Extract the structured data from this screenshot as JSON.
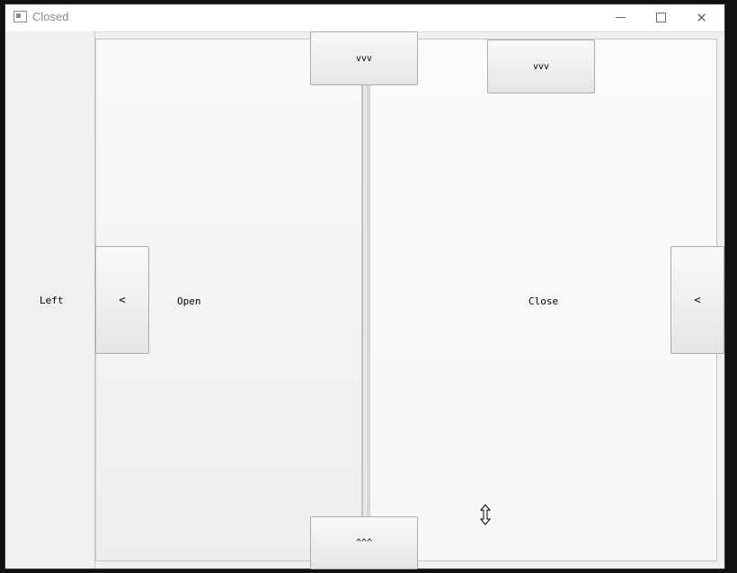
{
  "window": {
    "title": "Closed",
    "controls": {
      "minimize": "—",
      "maximize": "□",
      "close": "✕"
    }
  },
  "left_panel": {
    "label": "Left"
  },
  "open_panel": {
    "label": "Open",
    "collapse_button": "<"
  },
  "close_panel": {
    "label": "Close",
    "collapse_button": "<"
  },
  "buttons": {
    "top_center": "vvv",
    "top_right": "vvv",
    "bottom_center": "^^^"
  }
}
